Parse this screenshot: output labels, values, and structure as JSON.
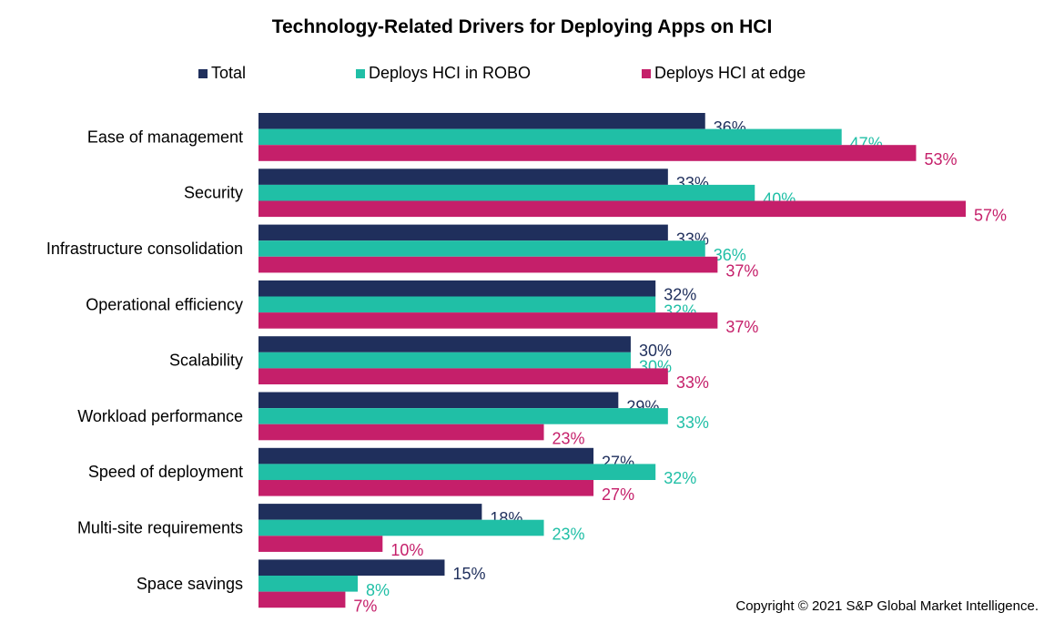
{
  "chart_data": {
    "type": "bar",
    "orientation": "horizontal",
    "title": "Technology-Related Drivers for Deploying Apps on HCI",
    "xlabel": "",
    "ylabel": "",
    "xlim": [
      0,
      60
    ],
    "grid": false,
    "legend_position": "top",
    "categories": [
      "Ease of management",
      "Security",
      "Infrastructure consolidation",
      "Operational efficiency",
      "Scalability",
      "Workload performance",
      "Speed of deployment",
      "Multi-site requirements",
      "Space savings"
    ],
    "series": [
      {
        "name": "Total",
        "color": "#1f2f5c",
        "values": [
          36,
          33,
          33,
          32,
          30,
          29,
          27,
          18,
          15
        ]
      },
      {
        "name": "Deploys HCI in ROBO",
        "color": "#20bfa6",
        "values": [
          47,
          40,
          36,
          32,
          30,
          33,
          32,
          23,
          8
        ]
      },
      {
        "name": "Deploys HCI at edge",
        "color": "#c51f6a",
        "values": [
          53,
          57,
          37,
          37,
          33,
          23,
          27,
          10,
          7
        ]
      }
    ],
    "value_suffix": "%"
  },
  "footer": {
    "copyright": "Copyright © 2021 S&P Global Market Intelligence."
  }
}
